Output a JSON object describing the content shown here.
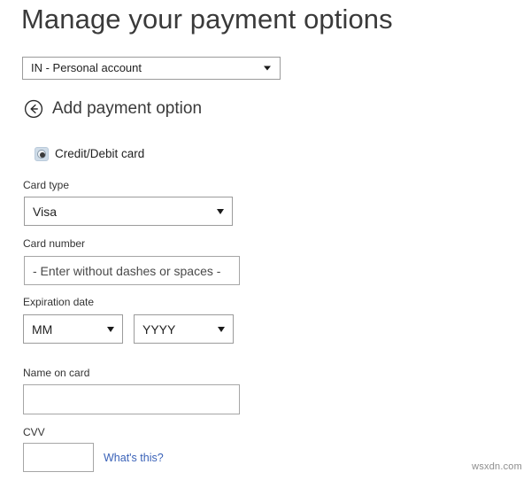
{
  "page": {
    "title": "Manage your payment options",
    "watermark": "wsxdn.com"
  },
  "account_selector": {
    "name": "account-select",
    "selected": "IN - Personal account",
    "caret_icon": "chevron-down-icon"
  },
  "subheader": {
    "back_icon": "circled-back-arrow-icon",
    "title": "Add payment option"
  },
  "payment_method": {
    "radio_icon": "radio-selected-icon",
    "label": "Credit/Debit card",
    "selected": true
  },
  "form": {
    "card_type": {
      "label": "Card type",
      "selected": "Visa",
      "caret_icon": "chevron-down-icon"
    },
    "card_number": {
      "label": "Card number",
      "value": "",
      "placeholder": "- Enter without dashes or spaces -"
    },
    "expiration_date": {
      "label": "Expiration date",
      "month": {
        "selected": "MM",
        "caret_icon": "chevron-down-icon"
      },
      "year": {
        "selected": "YYYY",
        "caret_icon": "chevron-down-icon"
      }
    },
    "name_on_card": {
      "label": "Name on card",
      "value": "",
      "placeholder": ""
    },
    "cvv": {
      "label": "CVV",
      "value": "",
      "placeholder": "",
      "help_link": "What's this?"
    }
  },
  "colors": {
    "link": "#3a62b8",
    "text": "#262626",
    "border": "#a6a6a6",
    "radio_accent": "#cfdce8"
  }
}
